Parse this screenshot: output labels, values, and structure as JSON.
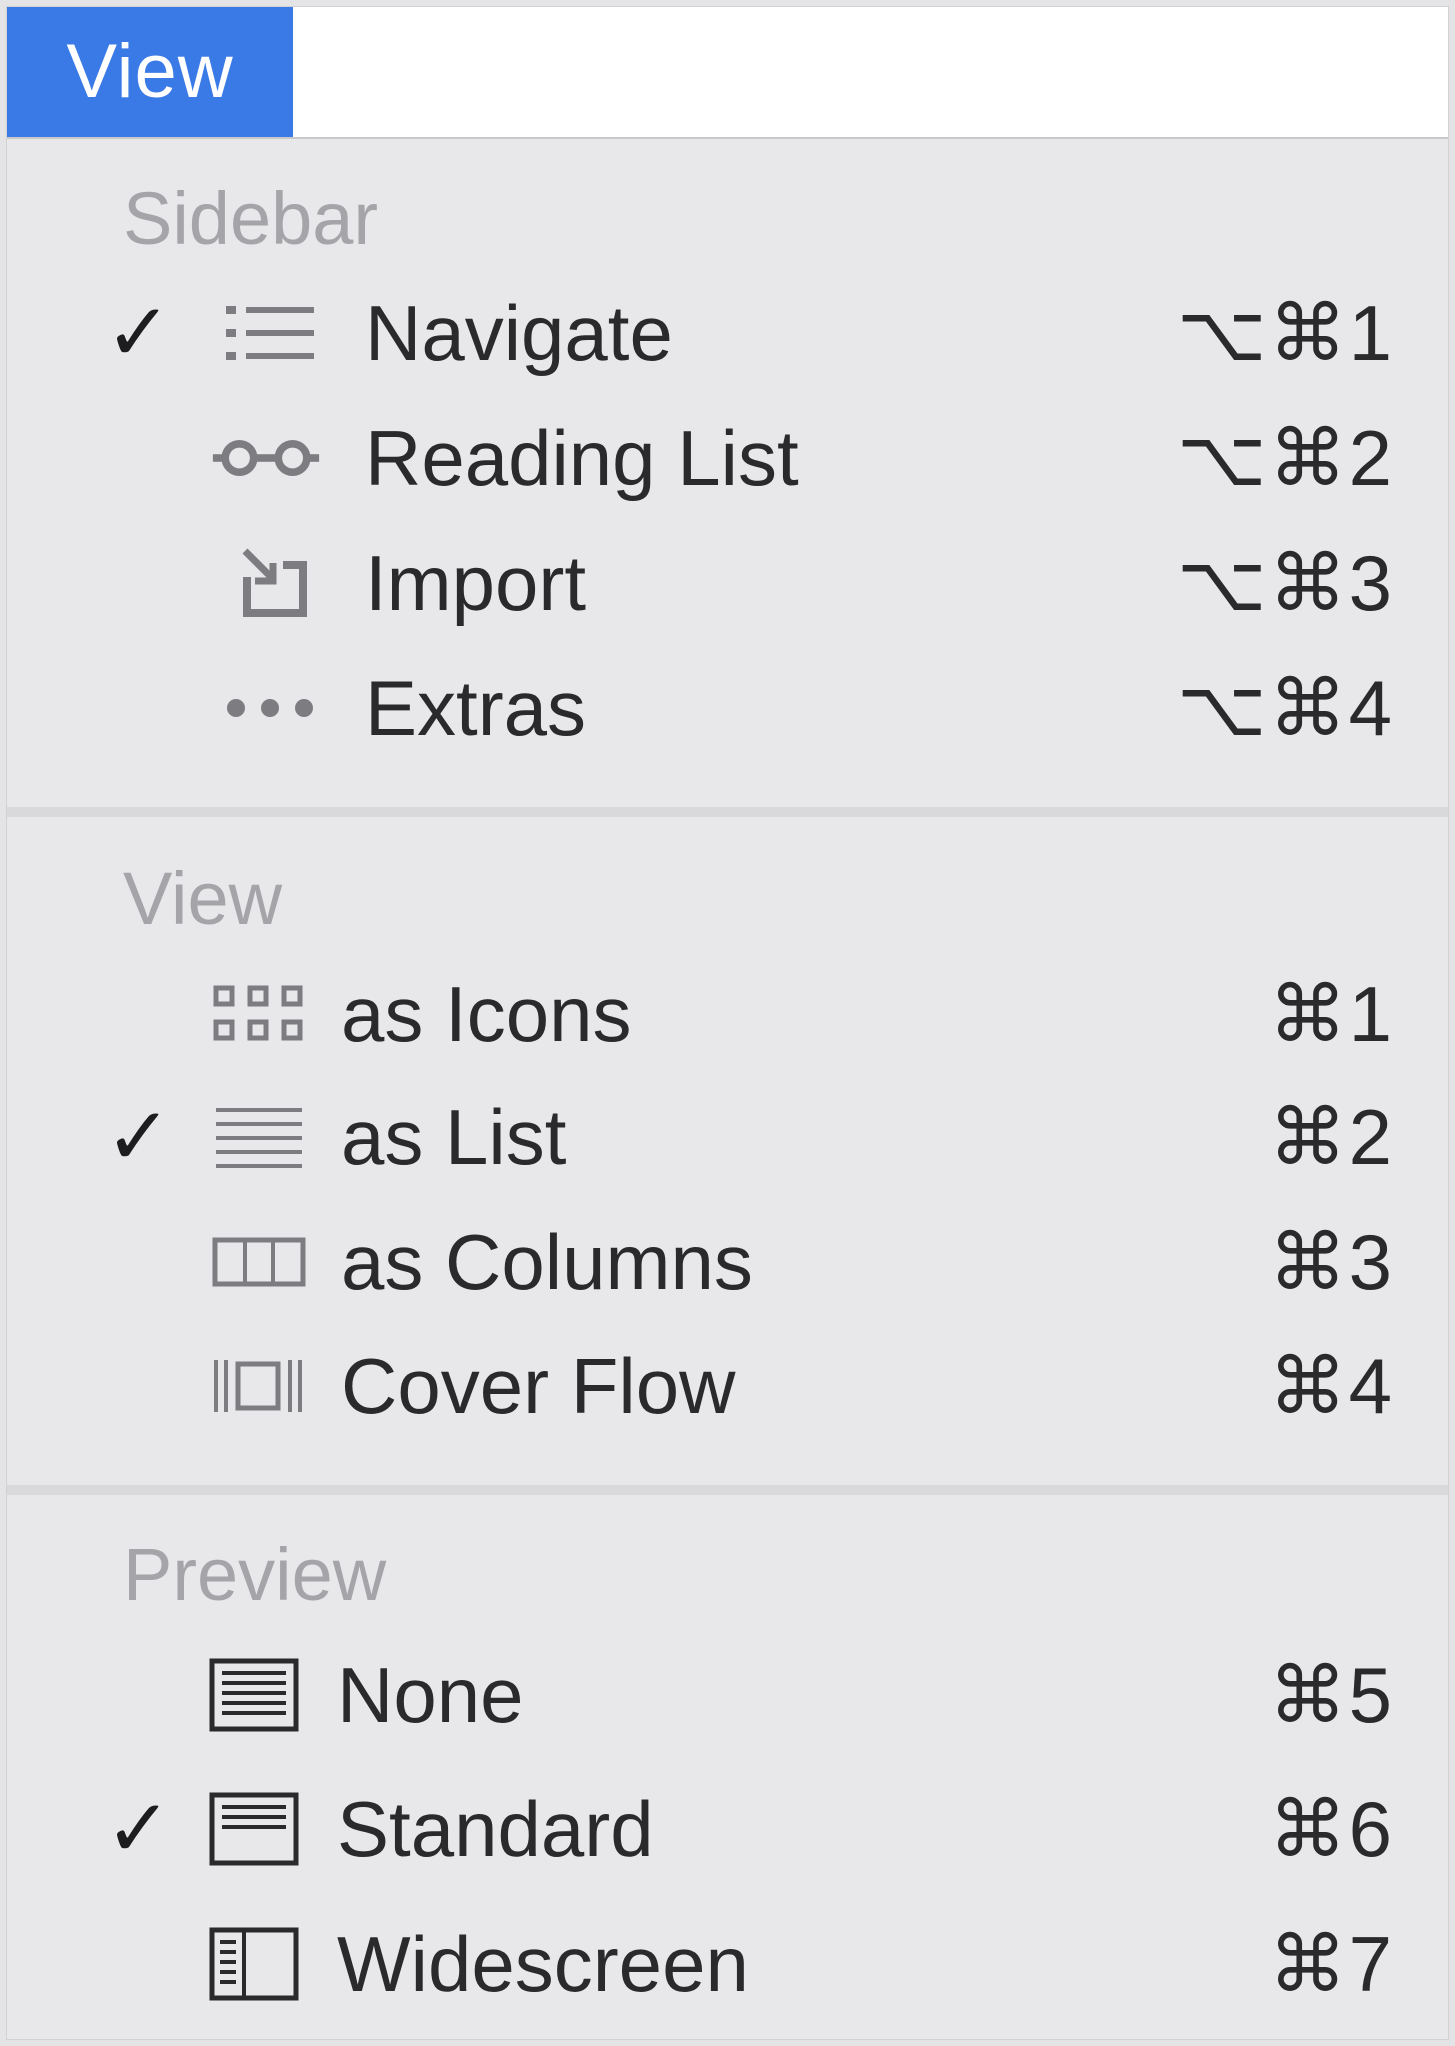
{
  "menu_title": "View",
  "sections": [
    {
      "header": "Sidebar",
      "items": [
        {
          "label": "Navigate",
          "shortcut": "⌥⌘1",
          "checked": true,
          "icon": "list-bullets-icon"
        },
        {
          "label": "Reading List",
          "shortcut": "⌥⌘2",
          "checked": false,
          "icon": "glasses-icon"
        },
        {
          "label": "Import",
          "shortcut": "⌥⌘3",
          "checked": false,
          "icon": "import-arrow-icon"
        },
        {
          "label": "Extras",
          "shortcut": "⌥⌘4",
          "checked": false,
          "icon": "ellipsis-icon"
        }
      ]
    },
    {
      "header": "View",
      "items": [
        {
          "label": "as Icons",
          "shortcut": "⌘1",
          "checked": false,
          "icon": "icon-grid-icon"
        },
        {
          "label": "as List",
          "shortcut": "⌘2",
          "checked": true,
          "icon": "list-lines-icon"
        },
        {
          "label": "as Columns",
          "shortcut": "⌘3",
          "checked": false,
          "icon": "columns-icon"
        },
        {
          "label": "Cover Flow",
          "shortcut": "⌘4",
          "checked": false,
          "icon": "cover-flow-icon"
        }
      ]
    },
    {
      "header": "Preview",
      "items": [
        {
          "label": "None",
          "shortcut": "⌘5",
          "checked": false,
          "icon": "preview-none-icon"
        },
        {
          "label": "Standard",
          "shortcut": "⌘6",
          "checked": true,
          "icon": "preview-standard-icon"
        },
        {
          "label": "Widescreen",
          "shortcut": "⌘7",
          "checked": false,
          "icon": "preview-widescreen-icon"
        }
      ]
    }
  ],
  "check_mark": "✓",
  "colors": {
    "accent": "#3a7ae6",
    "text": "#2a2a2c",
    "header": "#a5a5a9",
    "background": "#e8e8ea"
  }
}
